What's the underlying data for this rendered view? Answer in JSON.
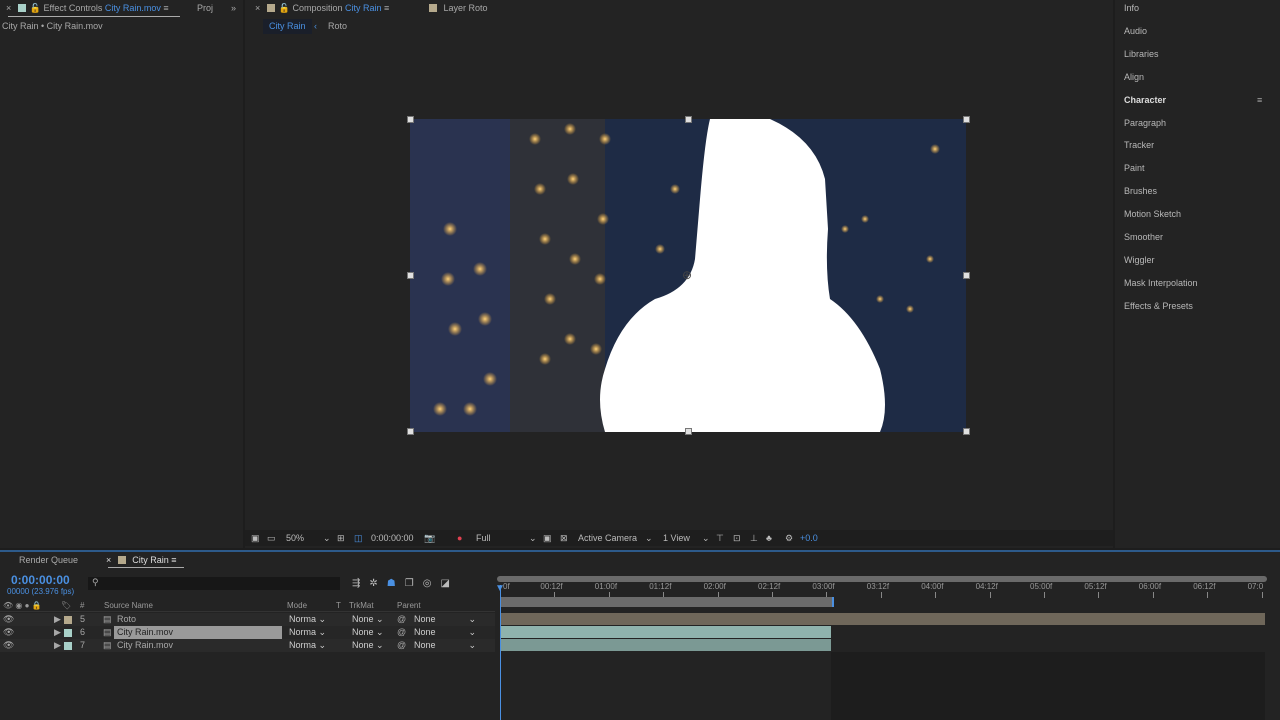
{
  "left_panel": {
    "tab_label": "Effect Controls",
    "tab_layer": "City Rain.mov",
    "next_tab": "Proj",
    "subtitle": "City Rain • City Rain.mov"
  },
  "comp_panel": {
    "tab_label": "Composition",
    "tab_comp": "City Rain",
    "layer_tab": "Layer Roto",
    "breadcrumbs": [
      "City Rain",
      "Roto"
    ]
  },
  "viewer_toolbar": {
    "zoom": "50%",
    "timecode": "0:00:00:00",
    "resolution": "Full",
    "camera": "Active Camera",
    "views": "1 View",
    "exposure": "+0.0"
  },
  "right_panel": {
    "items": [
      "Info",
      "Audio",
      "Libraries",
      "Align",
      "Character",
      "Paragraph",
      "Tracker",
      "Paint",
      "Brushes",
      "Motion Sketch",
      "Smoother",
      "Wiggler",
      "Mask Interpolation",
      "Effects & Presets"
    ],
    "active": "Character"
  },
  "timeline": {
    "tabs": [
      "Render Queue",
      "City Rain"
    ],
    "timecode": "0:00:00:00",
    "frame_info": "00000 (23.976 fps)",
    "columns": {
      "num": "#",
      "source": "Source Name",
      "mode": "Mode",
      "t": "T",
      "trkmat": "TrkMat",
      "parent": "Parent"
    },
    "layers": [
      {
        "num": "5",
        "name": "Roto",
        "mode": "Norma",
        "trkmat": "None",
        "parent": "None",
        "color": "#b5a98c"
      },
      {
        "num": "6",
        "name": "City Rain.mov",
        "mode": "Norma",
        "trkmat": "None",
        "parent": "None",
        "color": "#a8d0c8",
        "selected": true
      },
      {
        "num": "7",
        "name": "City Rain.mov",
        "mode": "Norma",
        "trkmat": "None",
        "parent": "None",
        "color": "#a8d0c8"
      }
    ],
    "ruler": [
      "0f",
      "00:12f",
      "01:00f",
      "01:12f",
      "02:00f",
      "02:12f",
      "03:00f",
      "03:12f",
      "04:00f",
      "04:12f",
      "05:00f",
      "05:12f",
      "06:00f",
      "06:12f",
      "07:0"
    ]
  }
}
